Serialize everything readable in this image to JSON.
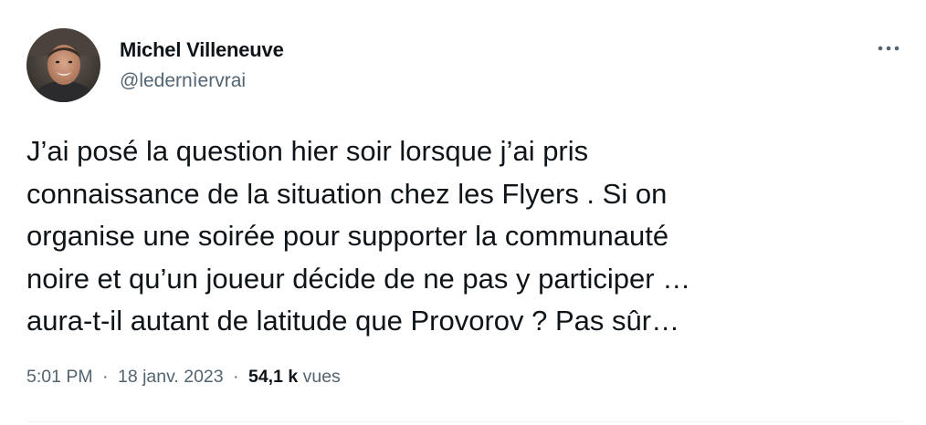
{
  "author": {
    "display_name": "Michel Villeneuve",
    "handle": "@ledernìervrai",
    "avatar_icon": "user-avatar-photo"
  },
  "menu": {
    "icon": "more-horizontal-icon"
  },
  "tweet": {
    "lines": [
      "J’ai posé la question hier soir lorsque j’ai pris",
      "connaissance de la situation chez les Flyers . Si on",
      "organise une soirée pour supporter la communauté",
      "noire et qu’un joueur décide de ne pas y participer …",
      "aura-t-il autant de latitude que Provorov ?  Pas sûr…"
    ]
  },
  "meta": {
    "time": "5:01 PM",
    "date": "18 janv. 2023",
    "separator": "·",
    "views_count": "54,1 k",
    "views_label": "vues"
  },
  "colors": {
    "text_primary": "#0f1419",
    "text_secondary": "#536471",
    "divider": "#eff3f4"
  }
}
